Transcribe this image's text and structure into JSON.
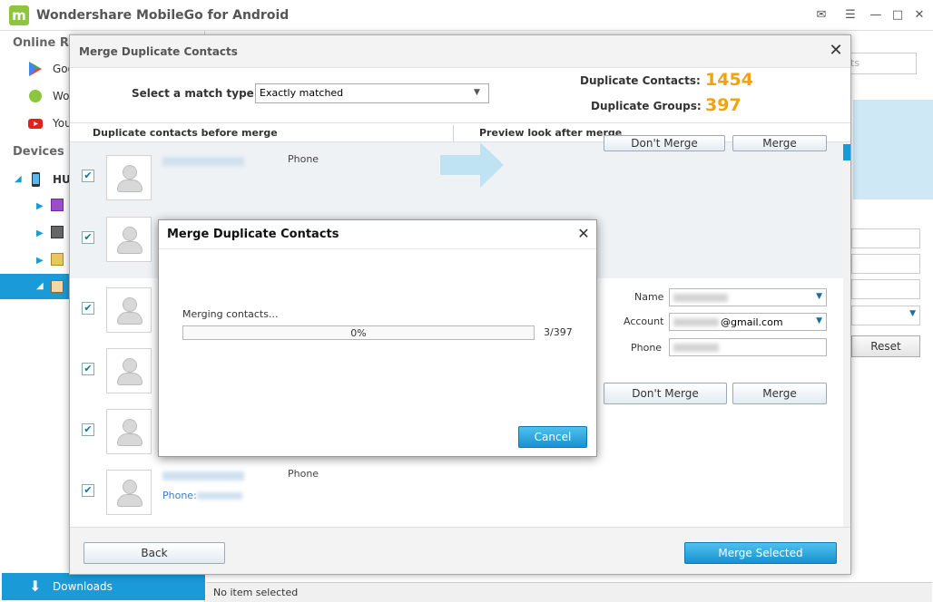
{
  "app": {
    "title": "Wondershare MobileGo for Android",
    "logo_letter": "m"
  },
  "sidebar": {
    "online_heading": "Online Res",
    "online_items": [
      {
        "label": "Goo",
        "icon": "google-play-icon"
      },
      {
        "label": "Wo",
        "icon": "wondershare-icon"
      },
      {
        "label": "You",
        "icon": "youtube-icon"
      }
    ],
    "devices_heading": "Devices",
    "device_name": "HU"
  },
  "downloads": {
    "label": "Downloads"
  },
  "status": {
    "text": "No item selected"
  },
  "background": {
    "search_placeholder": "ts",
    "reset_label": "Reset"
  },
  "merge_dialog": {
    "title": "Merge Duplicate Contacts",
    "match_type_label": "Select a match type:",
    "match_type_value": "Exactly matched",
    "dup_contacts_label": "Duplicate Contacts:",
    "dup_contacts_value": "1454",
    "dup_groups_label": "Duplicate Groups:",
    "dup_groups_value": "397",
    "col_before": "Duplicate contacts before merge",
    "col_after": "Preview look after merge",
    "rows": [
      {
        "type": "Phone",
        "phone_label": ""
      },
      {
        "type": "",
        "phone_label": ""
      },
      {
        "type": "",
        "phone_label": ""
      },
      {
        "type": "",
        "phone_label": ""
      },
      {
        "type": "",
        "phone_label": ""
      },
      {
        "type": "Phone",
        "phone_label": "Phone:"
      }
    ],
    "dont_merge_label": "Don't Merge",
    "merge_label": "Merge",
    "preview": {
      "name_label": "Name",
      "account_label": "Account",
      "account_suffix": "@gmail.com",
      "phone_label": "Phone"
    },
    "back_label": "Back",
    "merge_selected_label": "Merge Selected"
  },
  "progress_dialog": {
    "title": "Merge Duplicate Contacts",
    "status": "Merging contacts...",
    "percent_text": "0%",
    "percent_value": 0,
    "count": "3/397",
    "cancel_label": "Cancel"
  }
}
